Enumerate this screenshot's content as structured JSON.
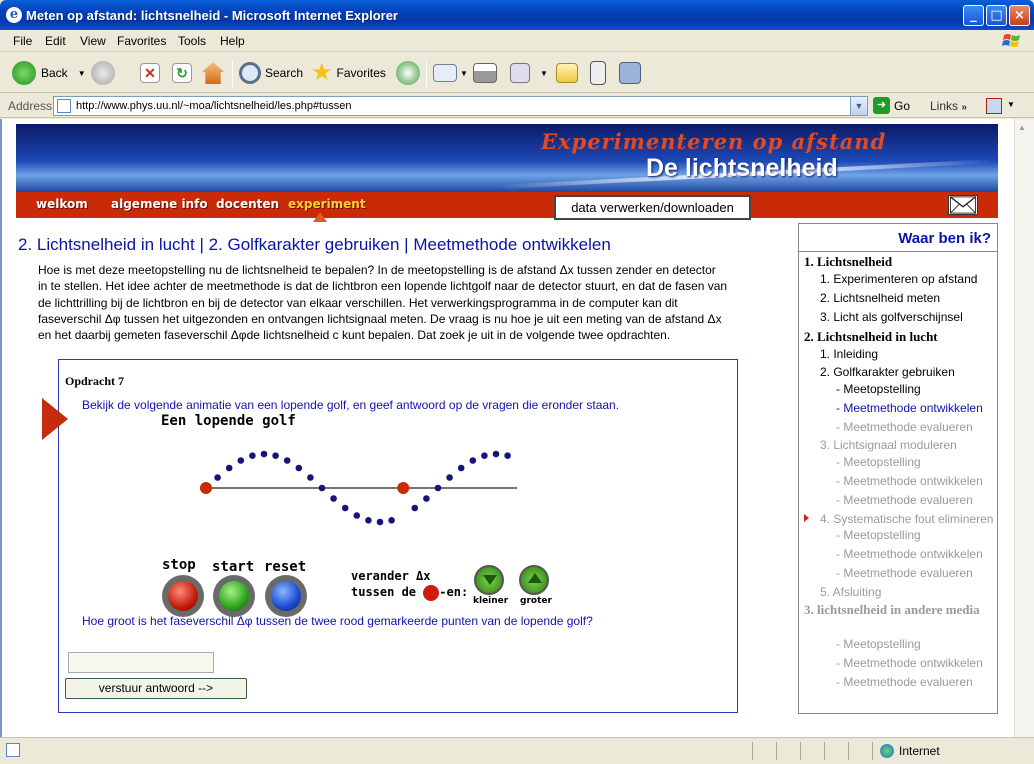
{
  "window": {
    "title": "Meten op afstand: lichtsnelheid - Microsoft Internet Explorer"
  },
  "menu": [
    "File",
    "Edit",
    "View",
    "Favorites",
    "Tools",
    "Help"
  ],
  "toolbar": {
    "back": "Back",
    "search": "Search",
    "favorites": "Favorites"
  },
  "address": {
    "label": "Address",
    "url": "http://www.phys.uu.nl/~moa/lichtsnelheid/les.php#tussen",
    "go": "Go",
    "links": "Links"
  },
  "banner": {
    "subtitle": "Experimenteren op afstand",
    "title": "De lichtsnelheid"
  },
  "nav": {
    "items": [
      "welkom",
      "algemene info",
      "docenten",
      "experiment"
    ],
    "active": "experiment",
    "data_button": "data verwerken/downloaden"
  },
  "main": {
    "heading": "2. Lichtsnelheid in lucht | 2. Golfkarakter gebruiken | Meetmethode ontwikkelen",
    "intro_lines": [
      "Hoe is met deze meetopstelling nu de lichtsnelheid te bepalen? In de meetopstelling is de afstand Δx tussen zender en detector",
      "in te stellen. Het idee achter de meetmethode is dat de lichtbron een lopende lichtgolf naar de detector stuurt, en dat de fasen van",
      "de lichttrilling bij de lichtbron en bij de detector van elkaar verschillen. Het verwerkingsprogramma in de computer kan dit",
      "faseverschil Δφ tussen het uitgezonden en ontvangen lichtsignaal meten. De vraag is nu hoe je uit een meting van de afstand Δx",
      "en het daarbij gemeten faseverschil Δφde lichtsnelheid c kunt bepalen. Dat zoek je uit in de volgende twee opdrachten."
    ],
    "assignment": {
      "title": "Opdracht 7",
      "question1": "Bekijk de volgende animatie van een lopende golf, en geef antwoord op de vragen die eronder staan.",
      "animation_title": "Een lopende golf",
      "buttons": {
        "stop": "stop",
        "start": "start",
        "reset": "reset"
      },
      "change_line1": "verander Δx",
      "change_line2a": "tussen de",
      "change_line2b": "-en:",
      "smaller": "kleiner",
      "larger": "groter",
      "question2": "Hoe groot is het faseverschil Δφ tussen de twee rood gemarkeerde punten van de lopende golf?",
      "answer_value": "",
      "submit": "verstuur antwoord -->"
    }
  },
  "sidebar": {
    "header": "Waar ben ik?",
    "items": [
      {
        "label": "1.  Lichtsnelheid",
        "style": "b"
      },
      {
        "label": "1. Experimenteren op afstand",
        "style": "n"
      },
      {
        "label": "2. Lichtsnelheid meten",
        "style": "n"
      },
      {
        "label": "3. Licht als golfverschijnsel",
        "style": "n"
      },
      {
        "label": "2. Lichtsnelheid in lucht",
        "style": "b"
      },
      {
        "label": "1. Inleiding",
        "style": "n"
      },
      {
        "label": "2. Golfkarakter gebruiken",
        "style": "n"
      },
      {
        "label": "- Meetopstelling",
        "style": "n"
      },
      {
        "label": "- Meetmethode ontwikkelen",
        "style": "cur"
      },
      {
        "label": "- Meetmethode evalueren",
        "style": "g"
      },
      {
        "label": "3. Lichtsignaal moduleren",
        "style": "g"
      },
      {
        "label": "- Meetopstelling",
        "style": "g"
      },
      {
        "label": "- Meetmethode ontwikkelen",
        "style": "g"
      },
      {
        "label": "- Meetmethode evalueren",
        "style": "g"
      },
      {
        "label": "4. Systematische fout elimineren",
        "style": "g"
      },
      {
        "label": "- Meetopstelling",
        "style": "g"
      },
      {
        "label": "- Meetmethode ontwikkelen",
        "style": "g"
      },
      {
        "label": "- Meetmethode evalueren",
        "style": "g"
      },
      {
        "label": "5. Afsluiting",
        "style": "g"
      },
      {
        "label": "3. lichtsnelheid in andere media",
        "style": "gb"
      },
      {
        "label": "- Meetopstelling",
        "style": "g"
      },
      {
        "label": "- Meetmethode ontwikkelen",
        "style": "g"
      },
      {
        "label": "- Meetmethode evalueren",
        "style": "g"
      }
    ]
  },
  "status": {
    "zone": "Internet"
  }
}
